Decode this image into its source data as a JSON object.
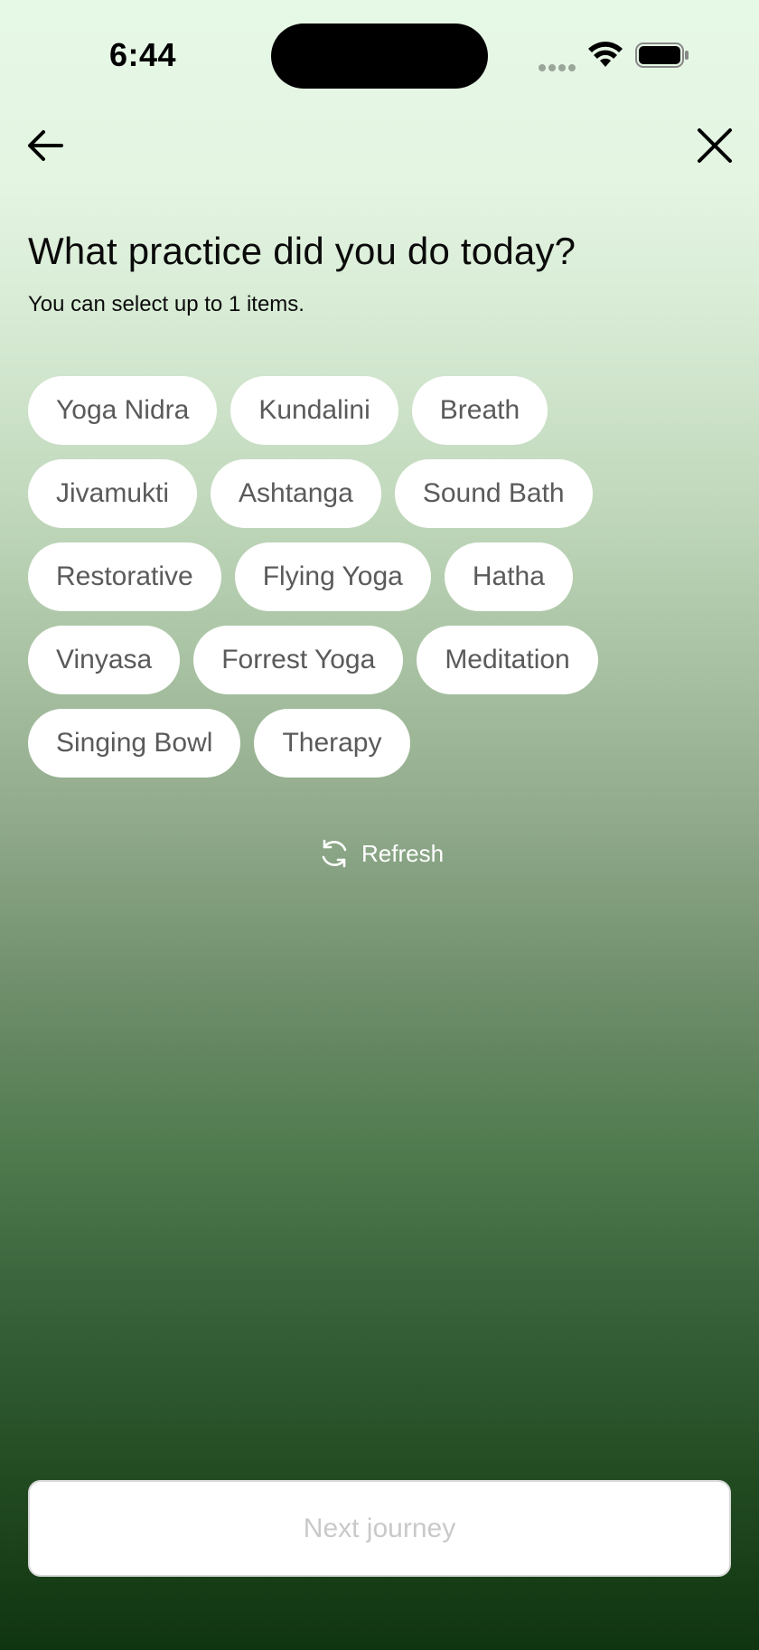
{
  "status_bar": {
    "time": "6:44",
    "icons": [
      "signal-dots-icon",
      "wifi-icon",
      "battery-icon"
    ]
  },
  "nav": {
    "back_icon": "arrow-left-icon",
    "close_icon": "close-icon"
  },
  "header": {
    "title": "What practice did you do today?",
    "subtitle": "You can select up to 1 items."
  },
  "chips": {
    "rows": [
      [
        "Yoga Nidra",
        "Kundalini",
        "Breath"
      ],
      [
        "Jivamukti",
        "Ashtanga",
        "Sound Bath"
      ],
      [
        "Restorative",
        "Flying Yoga",
        "Hatha"
      ],
      [
        "Vinyasa",
        "Forrest Yoga",
        "Meditation"
      ],
      [
        "Singing Bowl",
        "Therapy"
      ]
    ]
  },
  "refresh": {
    "label": "Refresh",
    "icon": "refresh-icon"
  },
  "footer": {
    "next_label": "Next journey"
  },
  "colors": {
    "gradient_top": "#e6f8e6",
    "gradient_bottom": "#0f3410",
    "chip_bg": "#ffffff",
    "chip_text": "#5a5a5a",
    "button_text_disabled": "#c9c9c9"
  }
}
